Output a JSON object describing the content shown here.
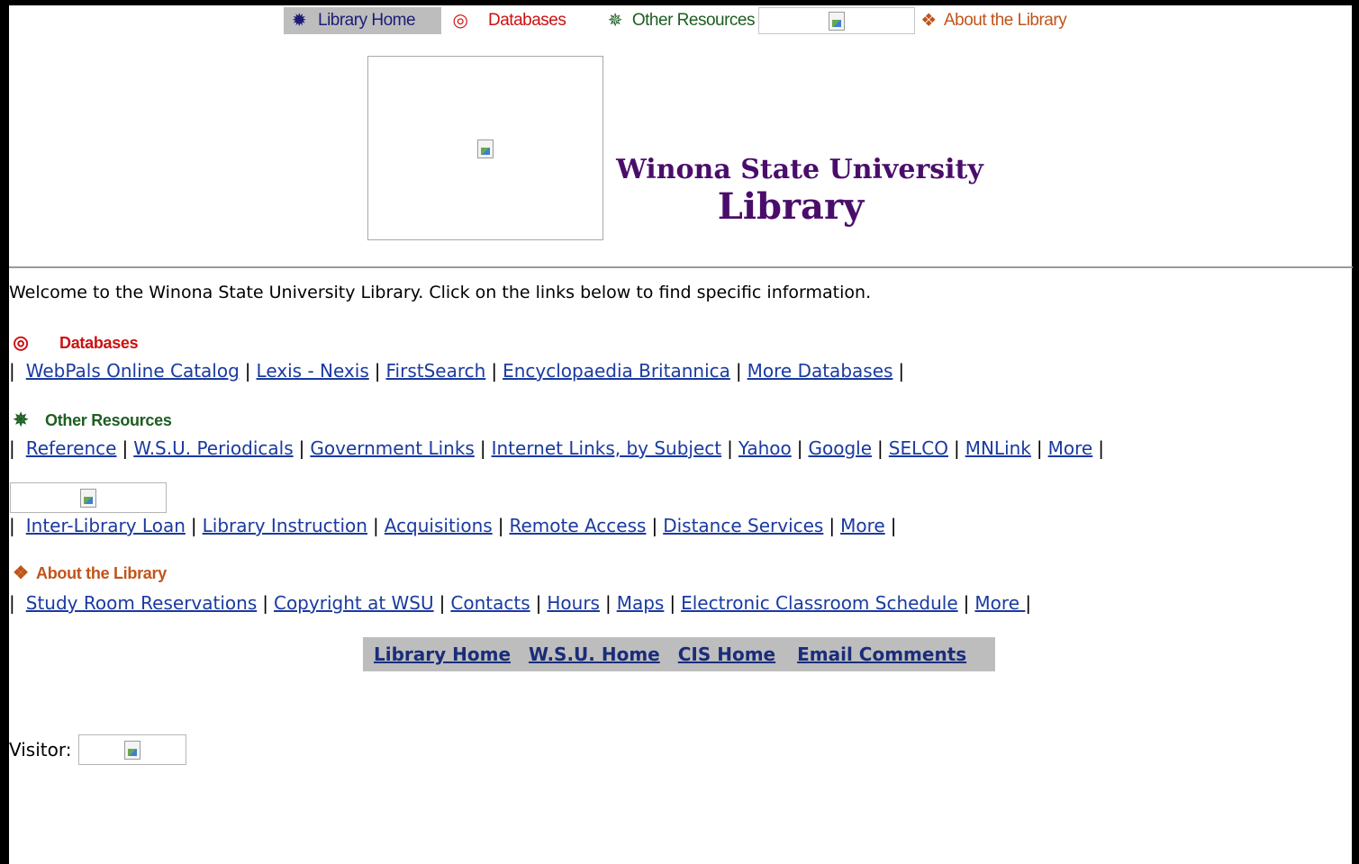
{
  "topnav": {
    "home": {
      "label": "Library Home",
      "icon": "wheel-icon",
      "color": "#1c1c78"
    },
    "databases": {
      "label": "Databases",
      "icon": "target-icon",
      "color": "#cc1111"
    },
    "other": {
      "label": "Other Resources",
      "icon": "star-burst-icon",
      "color": "#1d5e22"
    },
    "about": {
      "label": "About the Library",
      "icon": "diamond-flower-icon",
      "color": "#c0541a"
    }
  },
  "header": {
    "title_line1": "Winona State University",
    "title_line2": "Library",
    "title_color": "#4a0d6b"
  },
  "welcome": "Welcome to the Winona State University Library. Click on the links below to find specific information.",
  "sections": {
    "databases": {
      "heading": "Databases",
      "links": [
        "WebPals Online Catalog",
        "Lexis - Nexis",
        "FirstSearch",
        "Encyclopaedia Britannica",
        "More Databases"
      ]
    },
    "other": {
      "heading": "Other Resources",
      "links": [
        "Reference",
        "W.S.U. Periodicals",
        "Government Links",
        "Internet Links, by Subject",
        "Yahoo",
        "Google",
        "SELCO",
        "MNLink",
        "More"
      ]
    },
    "services": {
      "links": [
        "Inter-Library Loan",
        "Library Instruction",
        "Acquisitions",
        "Remote Access",
        "Distance Services",
        "More"
      ]
    },
    "about": {
      "heading": "About the Library",
      "links": [
        "Study Room Reservations",
        "Copyright at WSU",
        "Contacts",
        "Hours",
        "Maps",
        "Electronic Classroom Schedule",
        "More "
      ]
    }
  },
  "footer_links": [
    "Library Home",
    "W.S.U. Home",
    "CIS Home",
    "Email Comments"
  ],
  "visitor_label": "Visitor:"
}
